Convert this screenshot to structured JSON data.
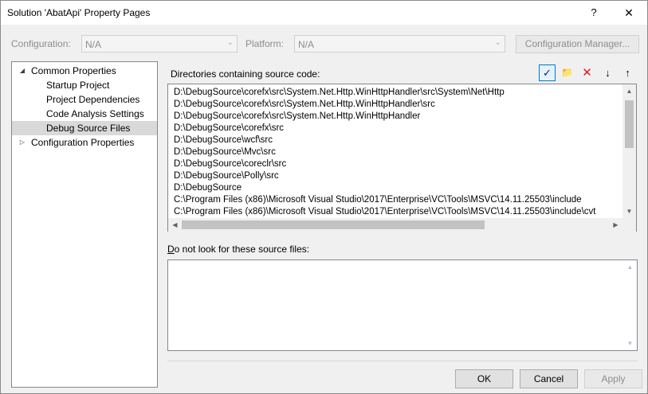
{
  "window": {
    "title": "Solution 'AbatApi' Property Pages",
    "help_label": "?",
    "close_label": "✕"
  },
  "config_bar": {
    "configuration_label": "Configuration:",
    "configuration_value": "N/A",
    "platform_label": "Platform:",
    "platform_value": "N/A",
    "manager_button": "Configuration Manager..."
  },
  "tree": {
    "items": [
      {
        "label": "Common Properties",
        "toggle": "◢",
        "level": 0
      },
      {
        "label": "Startup Project",
        "level": 1
      },
      {
        "label": "Project Dependencies",
        "level": 1
      },
      {
        "label": "Code Analysis Settings",
        "level": 1
      },
      {
        "label": "Debug Source Files",
        "level": 1,
        "selected": true
      },
      {
        "label": "Configuration Properties",
        "toggle": "▷",
        "level": 0
      }
    ]
  },
  "source_dirs": {
    "label": "Directories containing source code:",
    "toolbar": {
      "check_icon": "check-icon",
      "new_folder_icon": "new-folder-icon",
      "delete_icon": "delete-icon",
      "down_icon": "arrow-down-icon",
      "up_icon": "arrow-up-icon",
      "check_glyph": "✓",
      "new_folder_glyph": "📁",
      "delete_glyph": "✕",
      "down_glyph": "↓",
      "up_glyph": "↑"
    },
    "items": [
      "D:\\DebugSource\\corefx\\src\\System.Net.Http.WinHttpHandler\\src\\System\\Net\\Http",
      "D:\\DebugSource\\corefx\\src\\System.Net.Http.WinHttpHandler\\src",
      "D:\\DebugSource\\corefx\\src\\System.Net.Http.WinHttpHandler",
      "D:\\DebugSource\\corefx\\src",
      "D:\\DebugSource\\wcf\\src",
      "D:\\DebugSource\\Mvc\\src",
      "D:\\DebugSource\\coreclr\\src",
      "D:\\DebugSource\\Polly\\src",
      "D:\\DebugSource",
      "C:\\Program Files (x86)\\Microsoft Visual Studio\\2017\\Enterprise\\VC\\Tools\\MSVC\\14.11.25503\\include",
      "C:\\Program Files (x86)\\Microsoft Visual Studio\\2017\\Enterprise\\VC\\Tools\\MSVC\\14.11.25503\\include\\cvt"
    ]
  },
  "exclude_files": {
    "label_prefix": "D",
    "label_rest": "o not look for these source files:"
  },
  "buttons": {
    "ok": "OK",
    "cancel": "Cancel",
    "apply": "Apply"
  },
  "colors": {
    "accent": "#0078d7",
    "selection": "#cce8ff",
    "delete_red": "#e81123"
  }
}
